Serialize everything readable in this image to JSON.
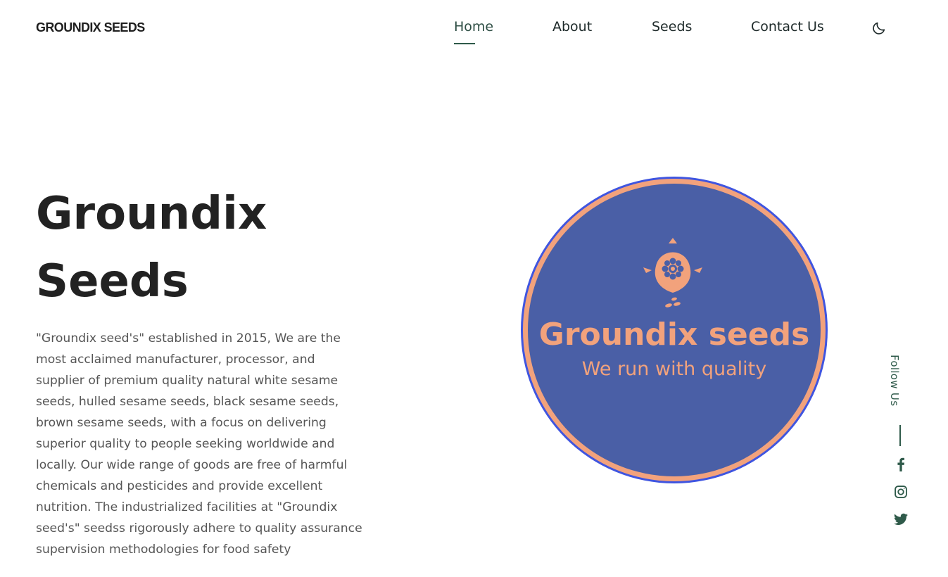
{
  "header": {
    "brand": "GROUNDIX SEEDS",
    "nav": [
      {
        "label": "Home",
        "active": true
      },
      {
        "label": "About",
        "active": false
      },
      {
        "label": "Seeds",
        "active": false
      },
      {
        "label": "Contact Us",
        "active": false
      }
    ],
    "theme_toggle_icon": "moon-icon"
  },
  "hero": {
    "title_line1": "Groundix",
    "title_line2": "Seeds",
    "description": "\"Groundix seed's\" established in 2015, We are the most acclaimed manufacturer, processor, and supplier of premium quality natural white sesame seeds, hulled sesame seeds, black sesame seeds, brown sesame seeds, with a focus on delivering superior quality to people seeking worldwide and locally. Our wide range of goods are free of harmful chemicals and pesticides and provide excellent nutrition. The industrialized facilities at \"Groundix seed's\" seedss rigorously adhere to quality assurance supervision methodologies for food safety"
  },
  "logo": {
    "name": "Groundix seeds",
    "tagline": "We run with quality",
    "colors": {
      "circle_fill": "#4a5fa6",
      "ring": "#f2a27c",
      "outer_ring": "#3f55e0",
      "text": "#f2a27c"
    }
  },
  "follow": {
    "label": "Follow Us",
    "icons": [
      "facebook-icon",
      "instagram-icon",
      "twitter-icon"
    ],
    "color": "#2f5a4a"
  }
}
